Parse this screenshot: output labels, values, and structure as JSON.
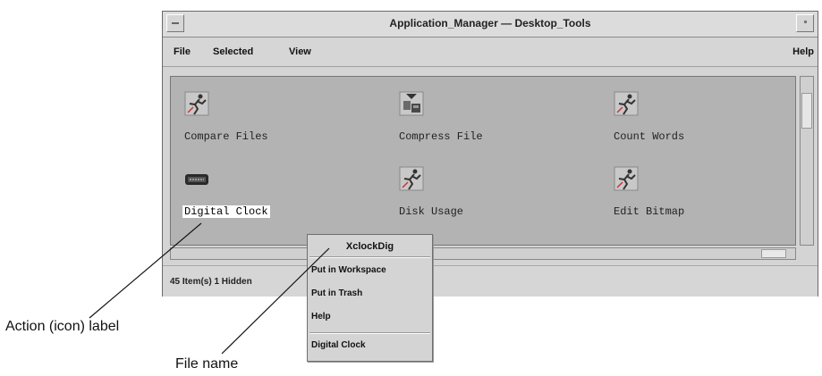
{
  "window": {
    "title": "Application_Manager — Desktop_Tools"
  },
  "menubar": {
    "file_label": "File",
    "selected_label": "Selected",
    "view_label": "View",
    "help_label": "Help"
  },
  "icons": [
    {
      "label": "Compare Files",
      "icon": "running-man-icon"
    },
    {
      "label": "Compress File",
      "icon": "compress-file-icon"
    },
    {
      "label": "Count Words",
      "icon": "running-man-icon"
    },
    {
      "label": "Digital Clock",
      "icon": "digital-clock-icon",
      "selected": true
    },
    {
      "label": "Disk Usage",
      "icon": "running-man-icon"
    },
    {
      "label": "Edit Bitmap",
      "icon": "running-man-icon"
    }
  ],
  "status": {
    "text": "45 Item(s) 1 Hidden"
  },
  "popup": {
    "title": "XclockDig",
    "items": [
      "Put in Workspace",
      "Put in Trash",
      "Help"
    ],
    "footer": "Digital Clock"
  },
  "annotations": {
    "action_label": "Action (icon) label",
    "file_name": "File name"
  }
}
